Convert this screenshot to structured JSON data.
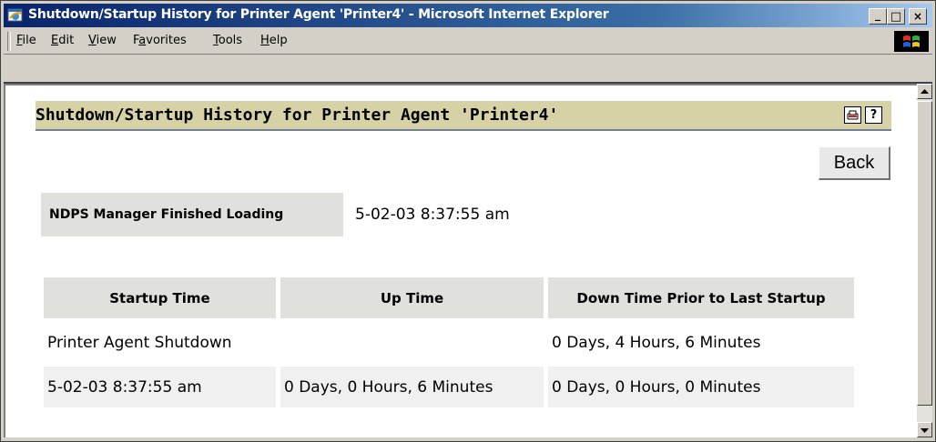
{
  "window": {
    "title": "Shutdown/Startup History for Printer Agent 'Printer4' - Microsoft Internet Explorer",
    "controls": [
      "_",
      "□",
      "×"
    ]
  },
  "menu": {
    "items": [
      {
        "pre": "",
        "u": "F",
        "post": "ile"
      },
      {
        "pre": "",
        "u": "E",
        "post": "dit"
      },
      {
        "pre": "",
        "u": "V",
        "post": "iew"
      },
      {
        "pre": "F",
        "u": "a",
        "post": "vorites"
      },
      {
        "pre": "",
        "u": "T",
        "post": "ools"
      },
      {
        "pre": "",
        "u": "H",
        "post": "elp"
      }
    ]
  },
  "page": {
    "title": "Shutdown/Startup History for Printer Agent 'Printer4'",
    "back_label": "Back",
    "loaded_label": "NDPS Manager Finished Loading",
    "loaded_value": "5-02-03 8:37:55 am",
    "help_icon_text": "?"
  },
  "table": {
    "headers": [
      "Startup Time",
      "Up Time",
      "Down Time Prior to Last Startup"
    ],
    "rows": [
      [
        "Printer Agent Shutdown",
        "",
        "0 Days, 4 Hours, 6 Minutes"
      ],
      [
        "5-02-03 8:37:55 am",
        "0 Days, 0 Hours, 6 Minutes",
        "0 Days, 0 Hours, 0 Minutes"
      ]
    ]
  },
  "colors": {
    "titlebar_start": "#0a246a",
    "header_bar": "#d6d2a6",
    "label_bg": "#e0e0dc"
  }
}
